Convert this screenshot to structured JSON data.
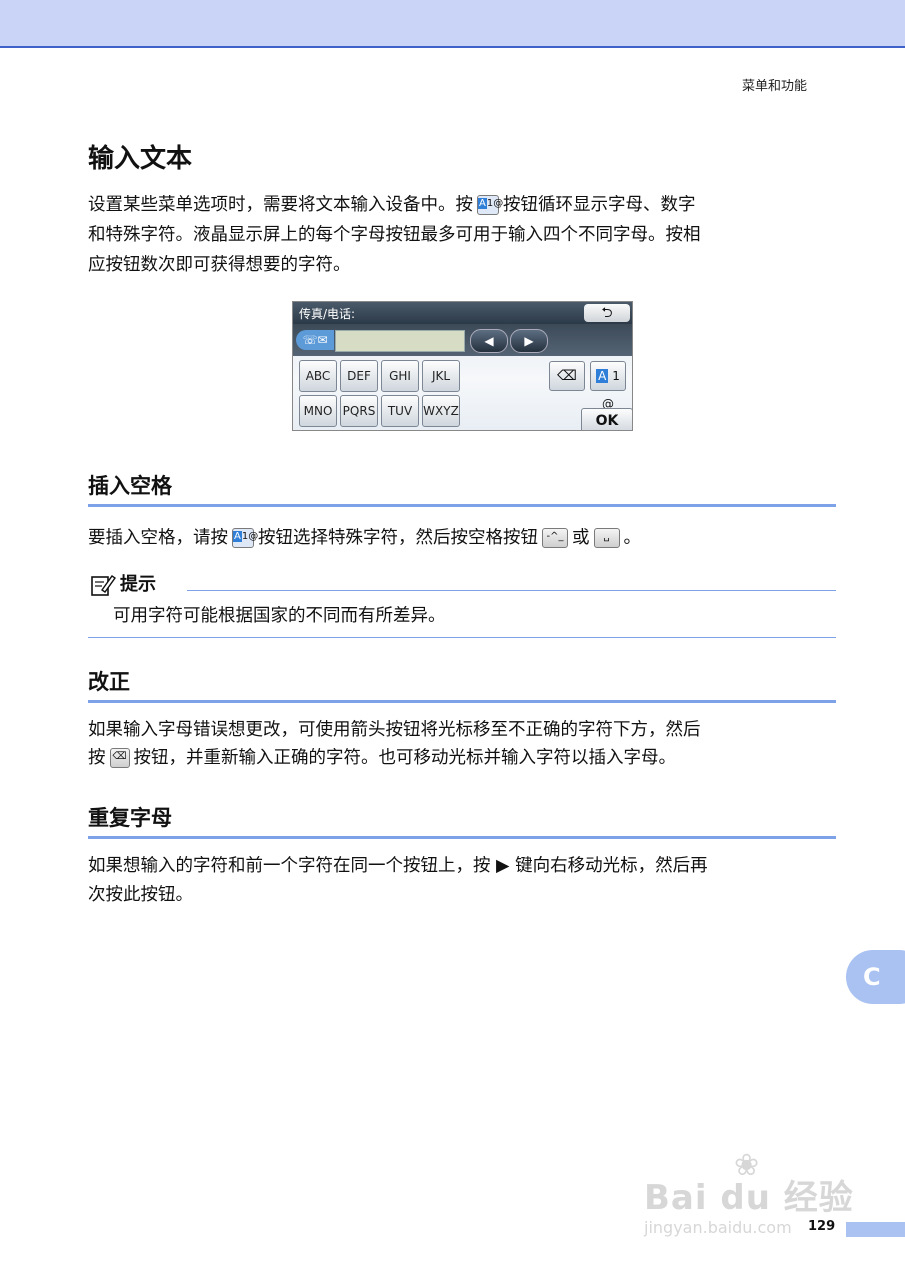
{
  "header": {
    "section": "菜单和功能"
  },
  "title": "输入文本",
  "intro": {
    "line1_a": "设置某些菜单选项时，需要将文本输入设备中。按",
    "line1_b": "按钮循环显示字母、数字",
    "line2": "和特殊字符。液晶显示屏上的每个字母按钮最多可用于输入四个不同字母。按相",
    "line3": "应按钮数次即可获得想要的字符。"
  },
  "lcd": {
    "label": "传真/电话:",
    "back": "⮌",
    "keys_row1": [
      "ABC",
      "DEF",
      "GHI",
      "JKL"
    ],
    "keys_row2": [
      "MNO",
      "PQRS",
      "TUV",
      "WXYZ"
    ],
    "mode_key_a": "A",
    "mode_key_rest": " 1 @",
    "ok": "OK"
  },
  "icons": {
    "a1_a": "A",
    "a1_rest": "1@"
  },
  "sections": {
    "insert_space": {
      "heading": "插入空格",
      "text_a": "要插入空格，请按",
      "text_b": "按钮选择特殊字符，然后按空格按钮",
      "text_c": "或",
      "text_d": "。"
    },
    "tip": {
      "label": "提示",
      "text": "可用字符可能根据国家的不同而有所差异。"
    },
    "correction": {
      "heading": "改正",
      "line1": "如果输入字母错误想更改，可使用箭头按钮将光标移至不正确的字符下方，然后",
      "line2_a": "按",
      "line2_b": "按钮，并重新输入正确的字符。也可移动光标并输入字符以插入字母。"
    },
    "repeat": {
      "heading": "重复字母",
      "line1": "如果想输入的字符和前一个字符在同一个按钮上，按 ▶ 键向右移动光标，然后再",
      "line2": "次按此按钮。"
    }
  },
  "tab_letter": "C",
  "watermark": {
    "main": "Bai du 经验",
    "sub": "jingyan.baidu.com"
  },
  "page_number": "129"
}
